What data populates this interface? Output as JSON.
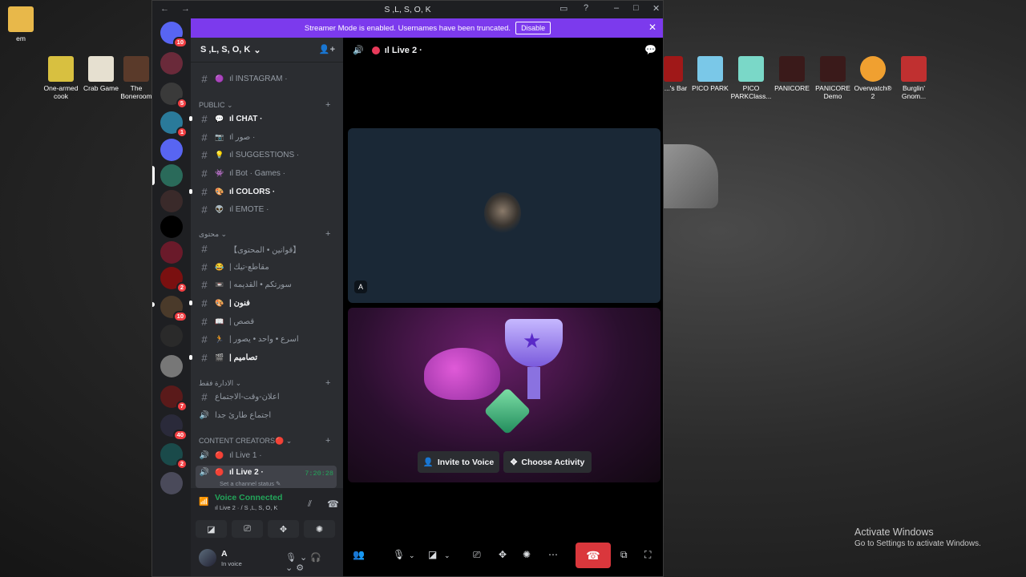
{
  "desktop": {
    "left_icons": [
      {
        "label": "em"
      },
      {
        "label": "One-armed cook"
      },
      {
        "label": "Crab Game"
      },
      {
        "label": "The Boneroom"
      }
    ],
    "right_icons": [
      {
        "label": "...'s Bar"
      },
      {
        "label": "PICO PARK"
      },
      {
        "label": "PICO PARKClass..."
      },
      {
        "label": "PANICORE"
      },
      {
        "label": "PANICORE Demo"
      },
      {
        "label": "Overwatch® 2"
      },
      {
        "label": "Burglin' Gnom..."
      }
    ],
    "watermark": {
      "line1": "Activate Windows",
      "line2": "Go to Settings to activate Windows."
    }
  },
  "window": {
    "title": "S ,L, S, O, K",
    "nav": "← →",
    "controls": {
      "inbox": "▭",
      "help": "?",
      "minimize": "–",
      "maximize": "□",
      "close": "✕"
    }
  },
  "banner": {
    "text": "Streamer Mode is enabled. Usernames have been truncated.",
    "button": "Disable",
    "close": "✕"
  },
  "rail": {
    "servers": [
      {
        "badge": "10",
        "color": "#5865f2"
      },
      {
        "badge": "",
        "color": "#6a2a3a"
      },
      {
        "badge": "5",
        "color": "#3a3a3a"
      },
      {
        "badge": "1",
        "color": "#2a7a9a"
      },
      {
        "badge": "",
        "color": "#5865f2"
      },
      {
        "badge": "",
        "color": "#2a6a5a"
      },
      {
        "badge": "",
        "color": "#3a2a2a"
      },
      {
        "badge": "",
        "color": "#000000"
      },
      {
        "badge": "",
        "color": "#6a1a2a"
      },
      {
        "badge": "2",
        "color": "#7a1010"
      },
      {
        "badge": "10",
        "color": "#4a3a2a"
      },
      {
        "badge": "",
        "color": "#2a2a2a"
      },
      {
        "badge": "",
        "color": "#777777"
      },
      {
        "badge": "7",
        "color": "#5a1a1a"
      },
      {
        "badge": "40",
        "color": "#2a2a3a"
      },
      {
        "badge": "2",
        "color": "#1a4a4a"
      },
      {
        "badge": "",
        "color": "#4a4a5a"
      }
    ]
  },
  "sidebar": {
    "server_name": "S ,L, S, O, K",
    "channels_top": [
      {
        "emoji": "🟣",
        "name": "ıl INSTAGRAM ·"
      }
    ],
    "categories": [
      {
        "name": "PUBLIC"
      },
      {
        "name": "محتوى"
      },
      {
        "name": "الادارة فقط"
      },
      {
        "name": "CONTENT CREATORS🔴"
      }
    ],
    "public_channels": [
      {
        "emoji": "💬",
        "name": "ıl CHAT ·",
        "unread": true
      },
      {
        "emoji": "📷",
        "name": "ıl صور ·",
        "unread": false
      },
      {
        "emoji": "💡",
        "name": "ıl SUGGESTIONS ·",
        "unread": false
      },
      {
        "emoji": "👾",
        "name": "ıl Bot · Games ·",
        "unread": false
      },
      {
        "emoji": "🎨",
        "name": "ıl COLORS ·",
        "unread": true
      },
      {
        "emoji": "👽",
        "name": "ıl EMOTE ·",
        "unread": false
      }
    ],
    "content_channels": [
      {
        "emoji": "",
        "name": "【قوانين • المحتوى】",
        "unread": false
      },
      {
        "emoji": "😂",
        "name": "| مقاطع-تيك",
        "unread": false
      },
      {
        "emoji": "📼",
        "name": "| سورتكم • القديمه",
        "unread": false
      },
      {
        "emoji": "🎨",
        "name": "| فنون",
        "unread": true
      },
      {
        "emoji": "📖",
        "name": "| قصص",
        "unread": false
      },
      {
        "emoji": "🏃",
        "name": "| اسرع • واحد • يصور",
        "unread": false
      },
      {
        "emoji": "🎬",
        "name": "| تصاميم",
        "unread": true
      }
    ],
    "admin_channels": [
      {
        "icon": "#",
        "name": "اعلان-وقت-الاجتماع"
      },
      {
        "icon": "🔊",
        "name": "اجتماع طارئ جدا"
      }
    ],
    "creator_channels": [
      {
        "emoji": "🔴",
        "name": "ıl Live 1 ·",
        "timer": "",
        "sub": ""
      },
      {
        "emoji": "🔴",
        "name": "ıl Live 2 ·",
        "timer": "7:20:28",
        "sub": "Set a channel status ✎"
      }
    ],
    "voice": {
      "status": "Voice Connected",
      "location": "ıl Live 2 · / S ,L, S, O, K"
    },
    "user": {
      "name": "A",
      "status": "In voice"
    }
  },
  "main": {
    "channel_title": "ıl Live 2 ·",
    "tile_label": "A",
    "invite_button": "Invite to Voice",
    "activity_button": "Choose Activity"
  }
}
